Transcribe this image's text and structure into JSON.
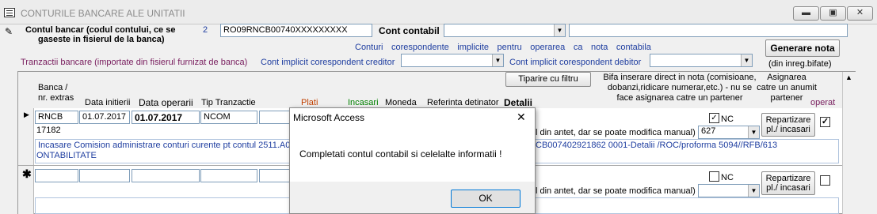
{
  "window": {
    "title": "CONTURILE BANCARE ALE UNITATII",
    "minimize": "▬",
    "maximize": "▣",
    "close": "✕"
  },
  "header": {
    "account_label_line1": "Contul bancar (codul contului, ce se",
    "account_label_line2": "gaseste in fisierul de la banca)",
    "account_index": "2",
    "account_value": "RO09RNCB00740XXXXXXXXX",
    "cont_contabil_label": "Cont contabil",
    "cont_contabil_value": "",
    "generare_nota": "Generare nota",
    "din_inreg_bifate": "(din inreg.bifate)",
    "corespondente_words": [
      "Conturi",
      "corespondente",
      "implicite",
      "pentru",
      "operarea",
      "ca",
      "nota",
      "contabila"
    ],
    "tranzactii_label": "Tranzactii bancare (importate din fisierul furnizat de banca)",
    "creditor_label": "Cont implicit corespondent creditor",
    "debitor_label": "Cont implicit corespondent debitor"
  },
  "grid": {
    "tiparire": "Tiparire cu filtru",
    "bifa_text_line1": "Bifa inserare direct in nota (comisioane,",
    "bifa_text_line2": "dobanzi,ridicare numerar,etc.) - nu se",
    "bifa_text_line3": "face asignarea catre un partener",
    "asignarea_line1": "Asignarea",
    "asignarea_line2": "catre un anumit",
    "asignarea_line3": "partener",
    "operat": "operat",
    "columns": {
      "banca_line1": "Banca /",
      "banca_line2": "nr. extras",
      "data_initierii": "Data initierii",
      "data_operarii": "Data operarii",
      "tip_tranzactie": "Tip Tranzactie",
      "plati": "Plati",
      "incasari": "Incasari",
      "moneda": "Moneda",
      "referinta": "Referinta detinator",
      "detalii": "Detalii"
    },
    "row1": {
      "selector": "▶",
      "banca": "RNCB",
      "extras": "17182",
      "data_initierii": "01.07.2017",
      "data_operarii": "01.07.2017",
      "tip": "NCOM",
      "nc_label": "NC",
      "nc_checked": "✓",
      "antet_text": "l din antet, dar se poate modifica manual)",
      "cont_value": "627",
      "repartizare_line1": "Repartizare",
      "repartizare_line2": "pl./ incasari",
      "operat_checked": "✓",
      "detail_line1": "Incasare Comision administrare conturi curente pt contul  2511.A0 1.",
      "detail_line1_right": "CB007402921862 0001-Detalii  /ROC/proforma 5094//RFB/613",
      "detail_line2": "ONTABILITATE"
    },
    "row2": {
      "selector": "✱",
      "nc_label": "NC",
      "antet_text": "l din antet, dar se poate modifica manual)",
      "repartizare_line1": "Repartizare",
      "repartizare_line2": "pl./ incasari"
    }
  },
  "dialog": {
    "title": "Microsoft Access",
    "close": "✕",
    "message": "Completati contul contabil si celelalte informatii !",
    "ok": "OK"
  },
  "colors": {
    "plati": "#c04000",
    "incasari": "#008000",
    "operat": "#7a2060",
    "link_blue": "#1f3ea0"
  }
}
